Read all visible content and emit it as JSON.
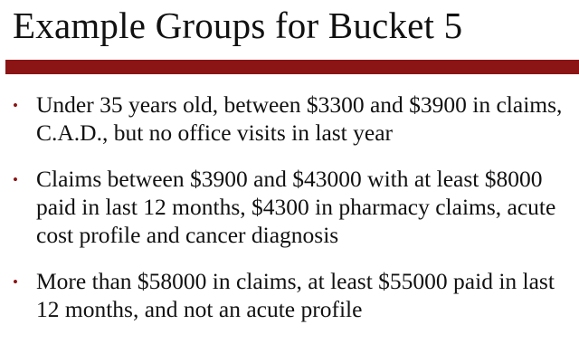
{
  "slide": {
    "title": "Example Groups for Bucket 5",
    "accent_color": "#8b1414",
    "bullets": [
      {
        "marker": "•",
        "text": "Under 35 years old, between $3300 and $3900 in claims, C.A.D., but no office visits in last year"
      },
      {
        "marker": "•",
        "text": "Claims between $3900 and $43000 with at least $8000 paid in last 12 months, $4300 in pharmacy claims, acute cost profile and cancer diagnosis"
      },
      {
        "marker": "•",
        "text": "More than $58000 in claims, at least $55000 paid in last 12 months, and not an acute profile"
      }
    ]
  }
}
